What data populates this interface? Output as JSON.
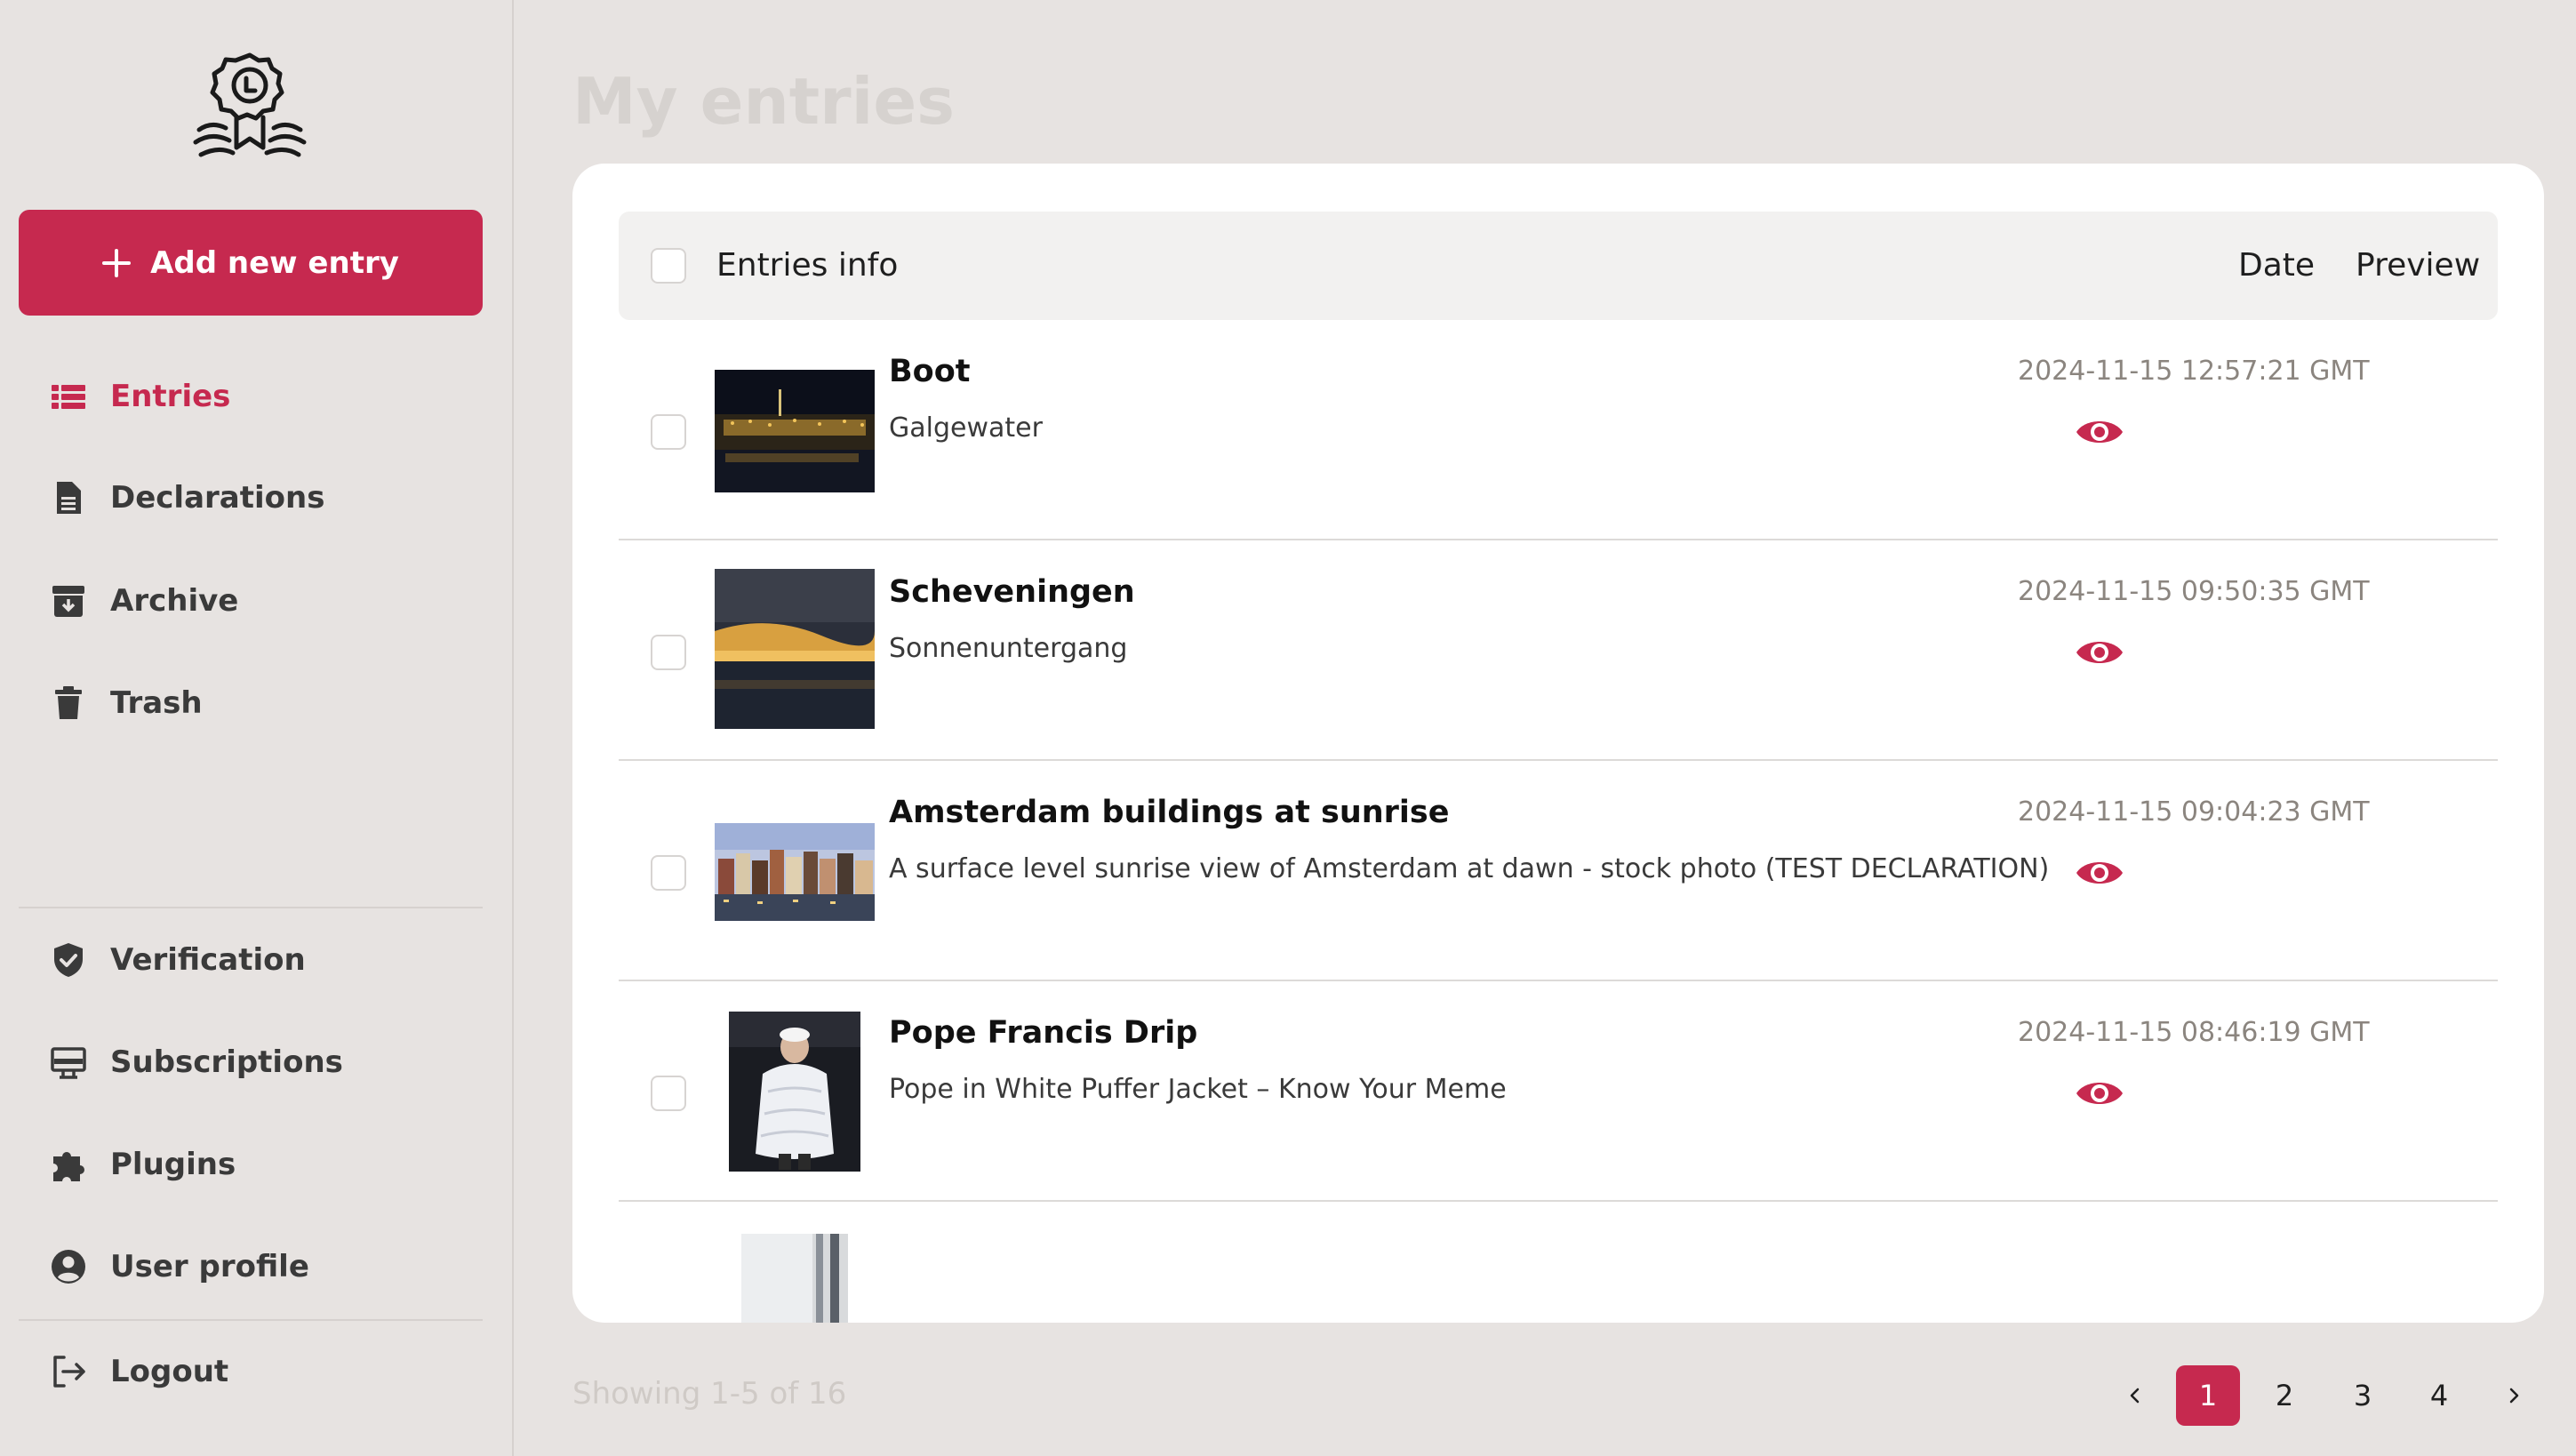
{
  "sidebar": {
    "add_button_label": "Add new entry",
    "nav": [
      {
        "label": "Entries",
        "icon": "list-icon",
        "active": true
      },
      {
        "label": "Declarations",
        "icon": "document-icon"
      },
      {
        "label": "Archive",
        "icon": "archive-icon"
      },
      {
        "label": "Trash",
        "icon": "trash-icon"
      }
    ],
    "nav_bottom": [
      {
        "label": "Verification",
        "icon": "shield-check-icon"
      },
      {
        "label": "Subscriptions",
        "icon": "subscriptions-icon"
      },
      {
        "label": "Plugins",
        "icon": "puzzle-icon"
      },
      {
        "label": "User profile",
        "icon": "user-circle-icon"
      }
    ],
    "logout_label": "Logout"
  },
  "main": {
    "title": "My entries",
    "table": {
      "header": {
        "info": "Entries info",
        "date": "Date",
        "preview": "Preview"
      },
      "rows": [
        {
          "title": "Boot",
          "subtitle": "Galgewater",
          "date": "2024-11-15 12:57:21 GMT"
        },
        {
          "title": "Scheveningen",
          "subtitle": "Sonnenuntergang",
          "date": "2024-11-15 09:50:35 GMT"
        },
        {
          "title": "Amsterdam buildings at sunrise",
          "subtitle": "A surface level sunrise view of Amsterdam at dawn - stock photo (TEST DECLARATION)",
          "date": "2024-11-15 09:04:23 GMT"
        },
        {
          "title": "Pope Francis Drip",
          "subtitle": "Pope in White Puffer Jacket – Know Your Meme",
          "date": "2024-11-15 08:46:19 GMT"
        }
      ]
    },
    "showing": "Showing 1-5 of 16",
    "pagination": {
      "pages": [
        "1",
        "2",
        "3",
        "4"
      ],
      "current": "1",
      "prev": "‹",
      "next": "›"
    }
  },
  "colors": {
    "accent": "#c6294f",
    "background": "#e7e3e1",
    "card": "#ffffff"
  }
}
